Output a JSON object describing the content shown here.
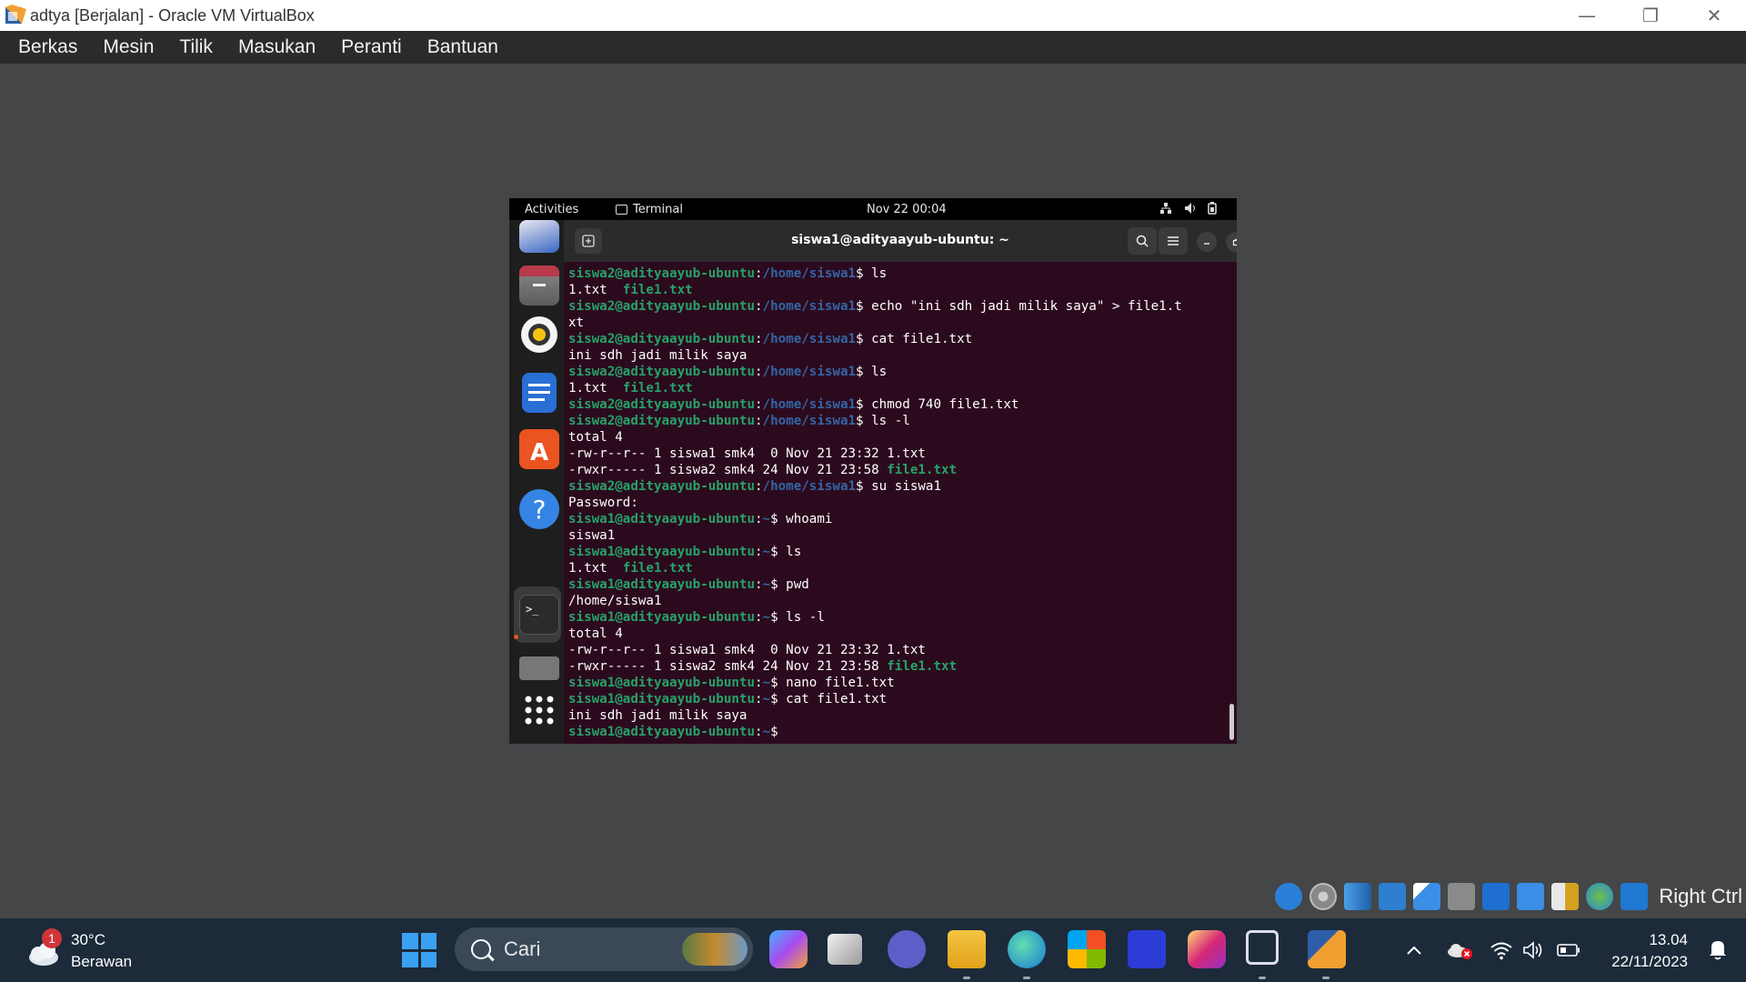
{
  "window": {
    "title": "adtya [Berjalan] - Oracle VM VirtualBox",
    "minimize_glyph": "—",
    "restore_glyph": "❐",
    "close_glyph": "✕"
  },
  "menubar": {
    "items": [
      "Berkas",
      "Mesin",
      "Tilik",
      "Masukan",
      "Peranti",
      "Bantuan"
    ]
  },
  "guest": {
    "topbar": {
      "activities": "Activities",
      "app_name": "Terminal",
      "clock": "Nov 22  00:04"
    },
    "terminal": {
      "title": "siswa1@adityaayub-ubuntu: ~",
      "lines": [
        {
          "user": "siswa2@adityaayub-ubuntu",
          "path": "/home/siswa1",
          "cmd": "ls"
        },
        {
          "out": "1.txt  ",
          "green": "file1.txt"
        },
        {
          "user": "siswa2@adityaayub-ubuntu",
          "path": "/home/siswa1",
          "cmd": "echo \"ini sdh jadi milik saya\" > file1.t"
        },
        {
          "out": "xt"
        },
        {
          "user": "siswa2@adityaayub-ubuntu",
          "path": "/home/siswa1",
          "cmd": "cat file1.txt"
        },
        {
          "out": "ini sdh jadi milik saya"
        },
        {
          "user": "siswa2@adityaayub-ubuntu",
          "path": "/home/siswa1",
          "cmd": "ls"
        },
        {
          "out": "1.txt  ",
          "green": "file1.txt"
        },
        {
          "user": "siswa2@adityaayub-ubuntu",
          "path": "/home/siswa1",
          "cmd": "chmod 740 file1.txt"
        },
        {
          "user": "siswa2@adityaayub-ubuntu",
          "path": "/home/siswa1",
          "cmd": "ls -l"
        },
        {
          "out": "total 4"
        },
        {
          "out": "-rw-r--r-- 1 siswa1 smk4  0 Nov 21 23:32 1.txt"
        },
        {
          "out": "-rwxr----- 1 siswa2 smk4 24 Nov 21 23:58 ",
          "green": "file1.txt"
        },
        {
          "user": "siswa2@adityaayub-ubuntu",
          "path": "/home/siswa1",
          "cmd": "su siswa1"
        },
        {
          "out": "Password:"
        },
        {
          "user": "siswa1@adityaayub-ubuntu",
          "path": "~",
          "cmd": "whoami"
        },
        {
          "out": "siswa1"
        },
        {
          "user": "siswa1@adityaayub-ubuntu",
          "path": "~",
          "cmd": "ls"
        },
        {
          "out": "1.txt  ",
          "green": "file1.txt"
        },
        {
          "user": "siswa1@adityaayub-ubuntu",
          "path": "~",
          "cmd": "pwd"
        },
        {
          "out": "/home/siswa1"
        },
        {
          "user": "siswa1@adityaayub-ubuntu",
          "path": "~",
          "cmd": "ls -l"
        },
        {
          "out": "total 4"
        },
        {
          "out": "-rw-r--r-- 1 siswa1 smk4  0 Nov 21 23:32 1.txt"
        },
        {
          "out": "-rwxr----- 1 siswa2 smk4 24 Nov 21 23:58 ",
          "green": "file1.txt"
        },
        {
          "user": "siswa1@adityaayub-ubuntu",
          "path": "~",
          "cmd": "nano file1.txt"
        },
        {
          "user": "siswa1@adityaayub-ubuntu",
          "path": "~",
          "cmd": "cat file1.txt"
        },
        {
          "out": "ini sdh jadi milik saya"
        },
        {
          "user": "siswa1@adityaayub-ubuntu",
          "path": "~",
          "cmd": ""
        }
      ]
    },
    "dock_icons": [
      "thunderbird-icon",
      "files-icon",
      "rhythmbox-icon",
      "writer-icon",
      "app-center-icon",
      "help-icon",
      "terminal-icon",
      "disk-icon",
      "show-apps-icon"
    ]
  },
  "statusbar": {
    "host_key": "Right Ctrl"
  },
  "taskbar": {
    "weather": {
      "badge": "1",
      "temp": "30°C",
      "desc": "Berawan"
    },
    "search_placeholder": "Cari",
    "clock_time": "13.04",
    "clock_date": "22/11/2023"
  },
  "colors": {
    "terminal_bg": "#2c0a1e",
    "prompt_user": "#26a269",
    "prompt_path": "#3465a4",
    "taskbar_bg": "#1c2a3a"
  }
}
